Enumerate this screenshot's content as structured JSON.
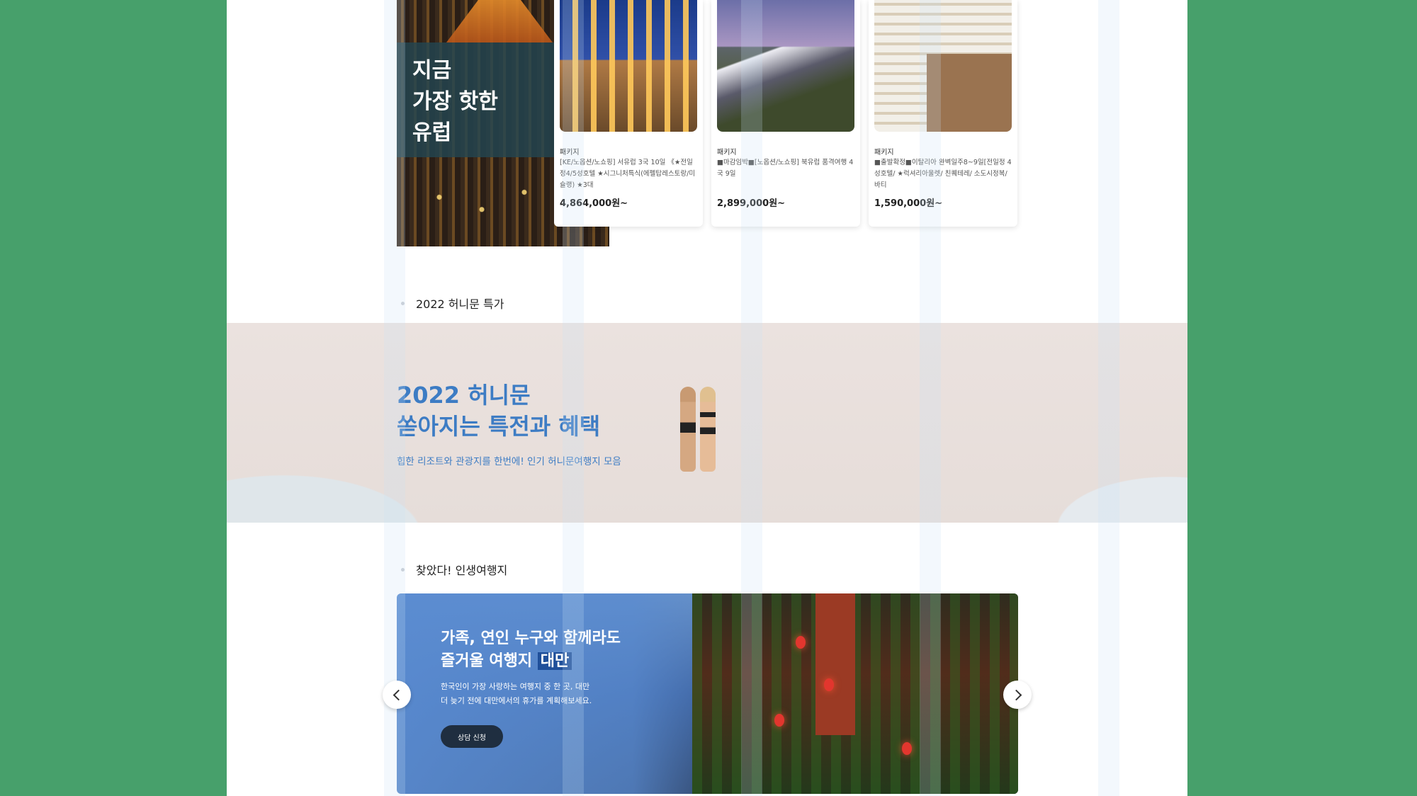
{
  "europe": {
    "hero_title": "지금\n가장 핫한\n유럽",
    "cards": [
      {
        "category": "패키지",
        "desc": "[KE/노옵션/노쇼핑] 서유럽 3국 10일 《★전일정4/5성호텔 ★시그니처특식(에펠탑레스토랑/미슐랭) ★3대",
        "price": "4,864,000원~"
      },
      {
        "category": "패키지",
        "desc": "■마감임박■[노옵션/노쇼핑] 북유럽 품격여행 4국 9일",
        "price": "2,899,000원~"
      },
      {
        "category": "패키지",
        "desc": "■출발확정■이탈리아 완벽일주8~9일[전일정 4성호텔/ ★럭셔리아울렛/ 친퀘테레/ 소도시정복/ 바티",
        "price": "1,590,000원~"
      }
    ]
  },
  "honeymoon": {
    "section_title": "2022 허니문 특가",
    "headline": "2022 허니문\n쏟아지는 특전과 혜택",
    "sub": "힙한 리조트와 관광지를 한번에! 인기 허니문여행지 모음"
  },
  "taiwan": {
    "section_title": "찾았다! 인생여행지",
    "headline_line1": "가족, 연인 누구와 함께라도",
    "headline_line2_prefix": "즐거울 여행지 ",
    "headline_highlight": "대만",
    "body_line1": "한국인이 가장 사랑하는 여행지 중 한 곳, 대만",
    "body_line2": "더 늦기 전에 대만에서의 휴가를 계획해보세요.",
    "cta_label": "상담 신청"
  },
  "colors": {
    "outer_background": "#47a06b",
    "accent_blue": "#3d7cc4",
    "hero_overlay": "#23464f",
    "cta_dark": "#1f2e40"
  },
  "icons": {
    "prev": "chevron-left-icon",
    "next": "chevron-right-icon"
  }
}
